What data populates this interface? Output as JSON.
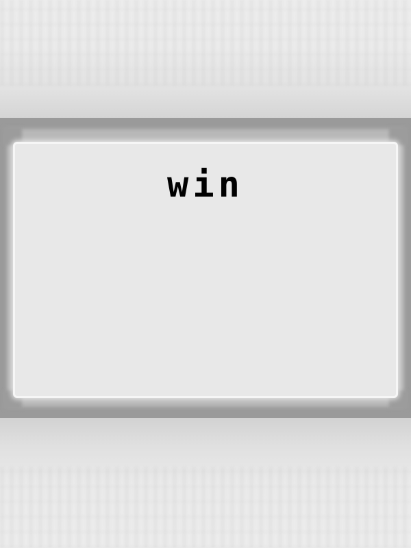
{
  "dialog": {
    "message": "win"
  },
  "colors": {
    "frame": "#9a9a9a",
    "panel": "#e8e8e8",
    "text": "#000000",
    "background": "#e6e6e6"
  }
}
